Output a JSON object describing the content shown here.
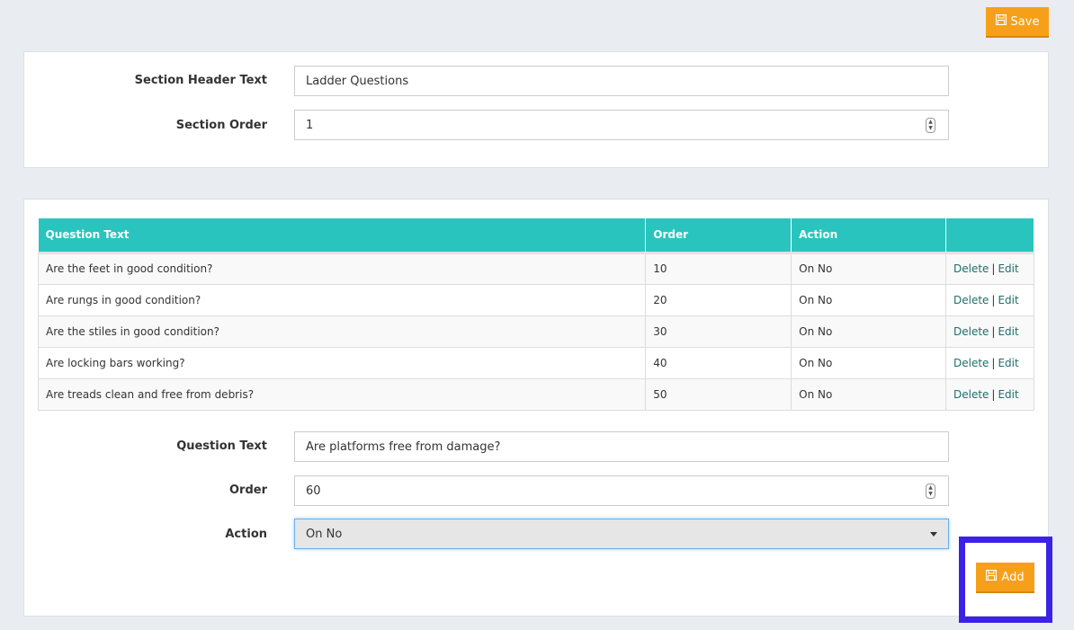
{
  "toolbar": {
    "save_label": "Save",
    "save_icon": "floppy-disk-icon"
  },
  "section": {
    "header_label": "Section Header Text",
    "header_value": "Ladder Questions",
    "order_label": "Section Order",
    "order_value": "1"
  },
  "questions_table": {
    "columns": [
      "Question Text",
      "Order",
      "Action",
      ""
    ],
    "rows": [
      {
        "text": "Are the feet in good condition?",
        "order": "10",
        "action": "On No",
        "delete": "Delete",
        "edit": "Edit"
      },
      {
        "text": "Are rungs in good condition?",
        "order": "20",
        "action": "On No",
        "delete": "Delete",
        "edit": "Edit"
      },
      {
        "text": "Are the stiles in good condition?",
        "order": "30",
        "action": "On No",
        "delete": "Delete",
        "edit": "Edit"
      },
      {
        "text": "Are locking bars working?",
        "order": "40",
        "action": "On No",
        "delete": "Delete",
        "edit": "Edit"
      },
      {
        "text": "Are treads clean and free from debris?",
        "order": "50",
        "action": "On No",
        "delete": "Delete",
        "edit": "Edit"
      }
    ]
  },
  "new_question": {
    "text_label": "Question Text",
    "text_value": "Are platforms free from damage?",
    "order_label": "Order",
    "order_value": "60",
    "action_label": "Action",
    "action_value": "On No",
    "add_label": "Add"
  },
  "colors": {
    "accent": "#f6a01a",
    "table_header": "#2ac4bf",
    "highlight": "#3c22e6"
  }
}
